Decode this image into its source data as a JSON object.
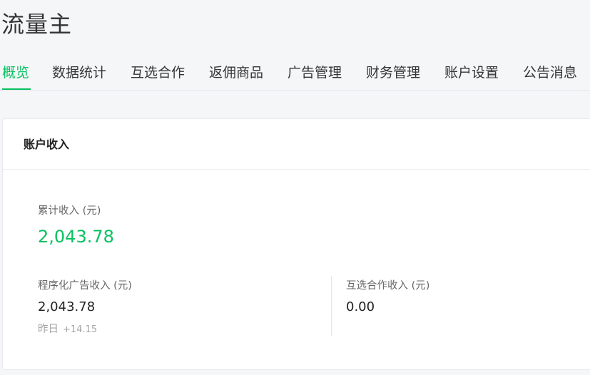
{
  "app": {
    "title": "流量主"
  },
  "tabs": [
    {
      "label": "概览",
      "active": true
    },
    {
      "label": "数据统计",
      "active": false
    },
    {
      "label": "互选合作",
      "active": false
    },
    {
      "label": "返佣商品",
      "active": false
    },
    {
      "label": "广告管理",
      "active": false
    },
    {
      "label": "财务管理",
      "active": false
    },
    {
      "label": "账户设置",
      "active": false
    },
    {
      "label": "公告消息",
      "active": false
    }
  ],
  "income_card": {
    "title": "账户收入",
    "total": {
      "label": "累计收入 (元)",
      "value": "2,043.78"
    },
    "programmatic_ads": {
      "label": "程序化广告收入 (元)",
      "value": "2,043.78",
      "yesterday_label": "昨日",
      "yesterday_delta": "+14.15"
    },
    "mutual_selection": {
      "label": "互选合作收入 (元)",
      "value": "0.00"
    }
  },
  "colors": {
    "accent": "#07c160",
    "background": "#f5f6f8",
    "card": "#ffffff",
    "muted_text": "#a6a6a6"
  }
}
